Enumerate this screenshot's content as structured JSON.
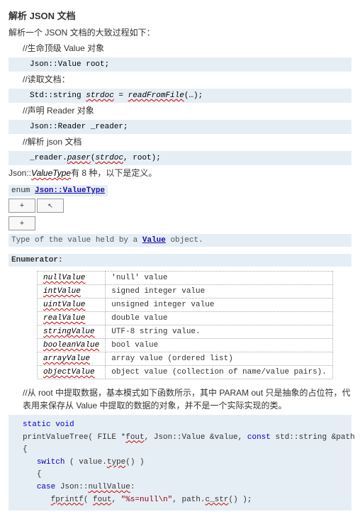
{
  "title": "解析 JSON 文档",
  "intro": "解析一个 JSON 文档的大致过程如下：",
  "sec1": {
    "comment": "//生命顶级 Value 对象",
    "code": "Json::Value root;"
  },
  "sec2": {
    "comment": "//读取文档：",
    "code_pre": "Std::string ",
    "code_var": "strdoc",
    "code_eq": " = ",
    "code_fn": "readFromFile",
    "code_tail": "(…);"
  },
  "sec3": {
    "comment": "//声明 Reader 对象",
    "code": "Json::Reader _reader;"
  },
  "sec4": {
    "comment": "//解析 json 文档",
    "code_pre": "_reader.",
    "code_fn": "paser",
    "code_args": "(",
    "code_a1": "strdoc",
    "code_mid": ", root);"
  },
  "valuetype_line_pre": "Json::",
  "valuetype_line_mid": "ValueType",
  "valuetype_line_tail": "有 8 种，以下是定义。",
  "enum_label_pre": "enum ",
  "enum_label_link": "Json::ValueType",
  "btn_plus": "+",
  "typeof_pre": "Type of the value held by a ",
  "typeof_link": "Value",
  "typeof_tail": " object.",
  "enumerator_hd": "Enumerator:",
  "rows": [
    {
      "name": "nullValue",
      "desc": "'null' value"
    },
    {
      "name": "intValue",
      "desc": "signed integer value"
    },
    {
      "name": "uintValue",
      "desc": "unsigned integer value"
    },
    {
      "name": "realValue",
      "desc": "double value"
    },
    {
      "name": "stringValue",
      "desc": "UTF-8 string value."
    },
    {
      "name": "booleanValue",
      "desc": "bool value"
    },
    {
      "name": "arrayValue",
      "desc": "array value (ordered list)"
    },
    {
      "name": "objectValue",
      "desc": "object value (collection of name/value pairs)."
    }
  ],
  "extract_para": "//从 root 中提取数据，基本模式如下函数所示，其中 PARAM out 只是抽象的占位符，代表用来保存从 Value 中提取的数据的对象，并不是一个实际实现的类。",
  "code2": {
    "l1a": "static",
    "l1b": " void",
    "l2a": "printValueTree( FILE *",
    "l2b": "fout",
    "l2c": ", Json::Value &value, ",
    "l2d": "const",
    "l2e": " std::string &path = ",
    "l2f": "\".\"",
    "l2g": " )",
    "l3": "{",
    "l4a": "switch",
    "l4b": " ( value.",
    "l4c": "type",
    "l4d": "() )",
    "l5": "{",
    "l6a": "case",
    "l6b": " Json::",
    "l6c": "nullValue",
    "l6d": ":",
    "l7a": "fprintf",
    "l7b": "( ",
    "l7c": "fout",
    "l7d": ", ",
    "l7e": "\"%s=null\\n\"",
    "l7f": ", path.",
    "l7g": "c_str",
    "l7h": "() );"
  }
}
